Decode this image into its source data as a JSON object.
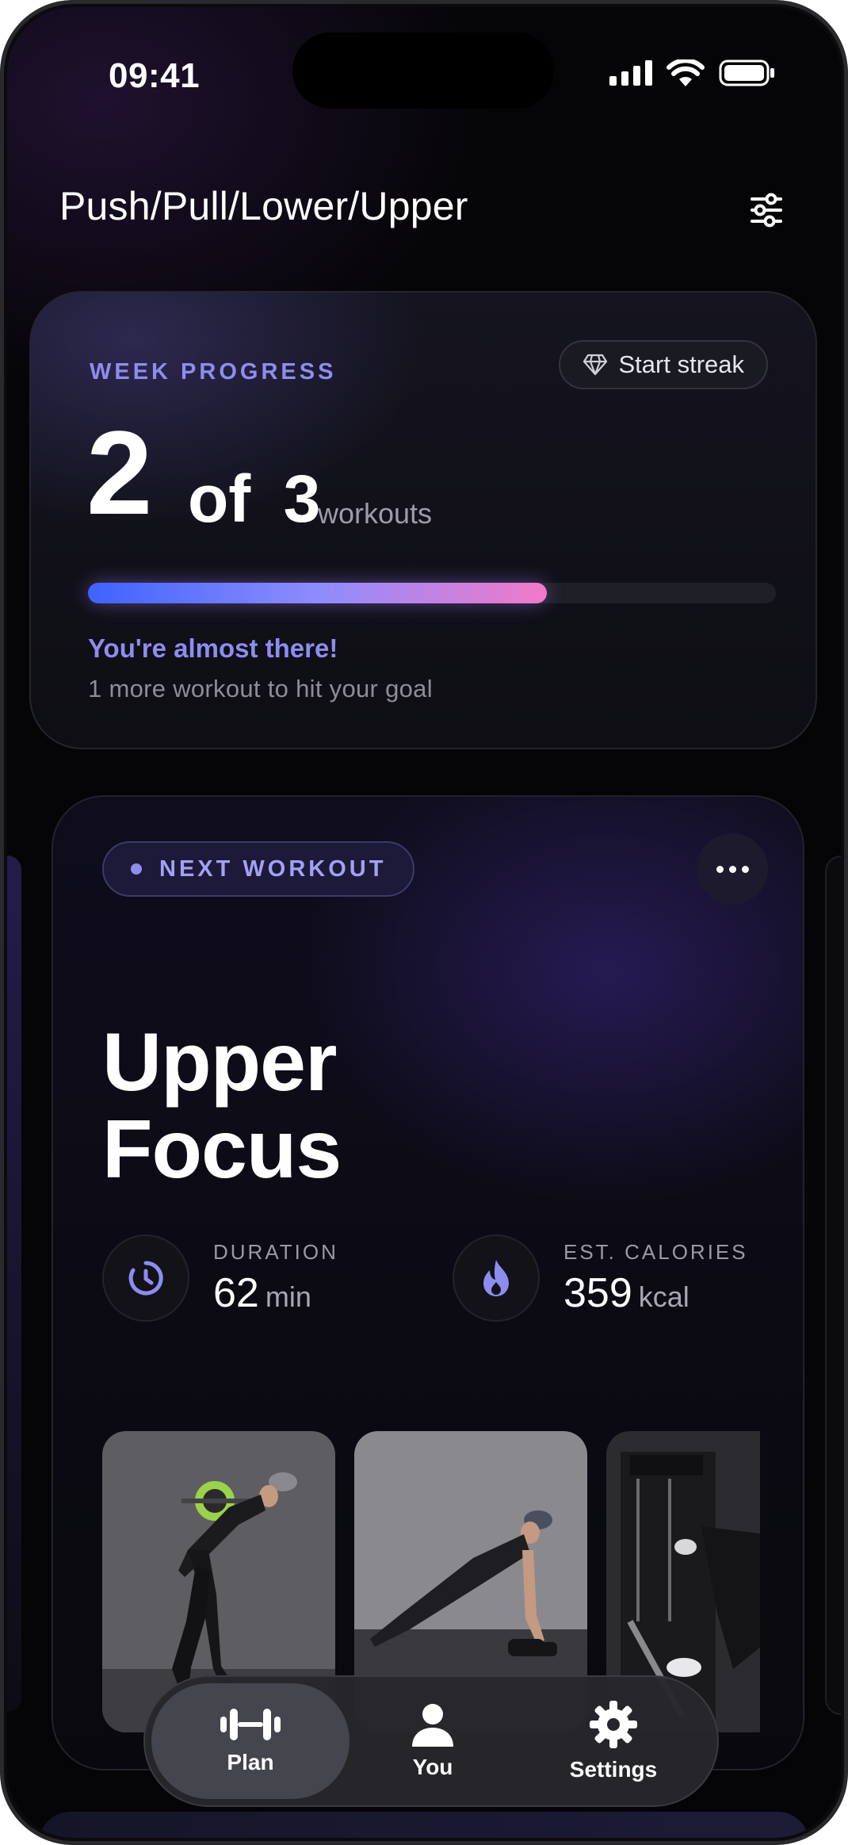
{
  "status_bar": {
    "time": "09:41"
  },
  "header": {
    "title": "Push/Pull/Lower/Upper"
  },
  "week_progress": {
    "label": "WEEK PROGRESS",
    "streak_button": "Start streak",
    "completed": "2",
    "of_label": "of",
    "total": "3",
    "unit": "workouts",
    "progress_fraction": 0.667,
    "message_title": "You're almost there!",
    "message_sub": "1 more workout to hit your goal"
  },
  "next_workout": {
    "badge": "NEXT WORKOUT",
    "title_line1": "Upper",
    "title_line2": "Focus",
    "duration": {
      "label": "DURATION",
      "value": "62",
      "unit": "min"
    },
    "calories": {
      "label": "EST. CALORIES",
      "value": "359",
      "unit": "kcal"
    }
  },
  "tabbar": {
    "items": [
      {
        "label": "Plan",
        "icon": "dumbbell-icon",
        "active": true
      },
      {
        "label": "You",
        "icon": "person-icon",
        "active": false
      },
      {
        "label": "Settings",
        "icon": "gear-icon",
        "active": false
      }
    ]
  },
  "colors": {
    "accent": "#8f8cf0",
    "progress_start": "#3e63ff",
    "progress_end": "#f27ac8",
    "background": "#050507"
  }
}
